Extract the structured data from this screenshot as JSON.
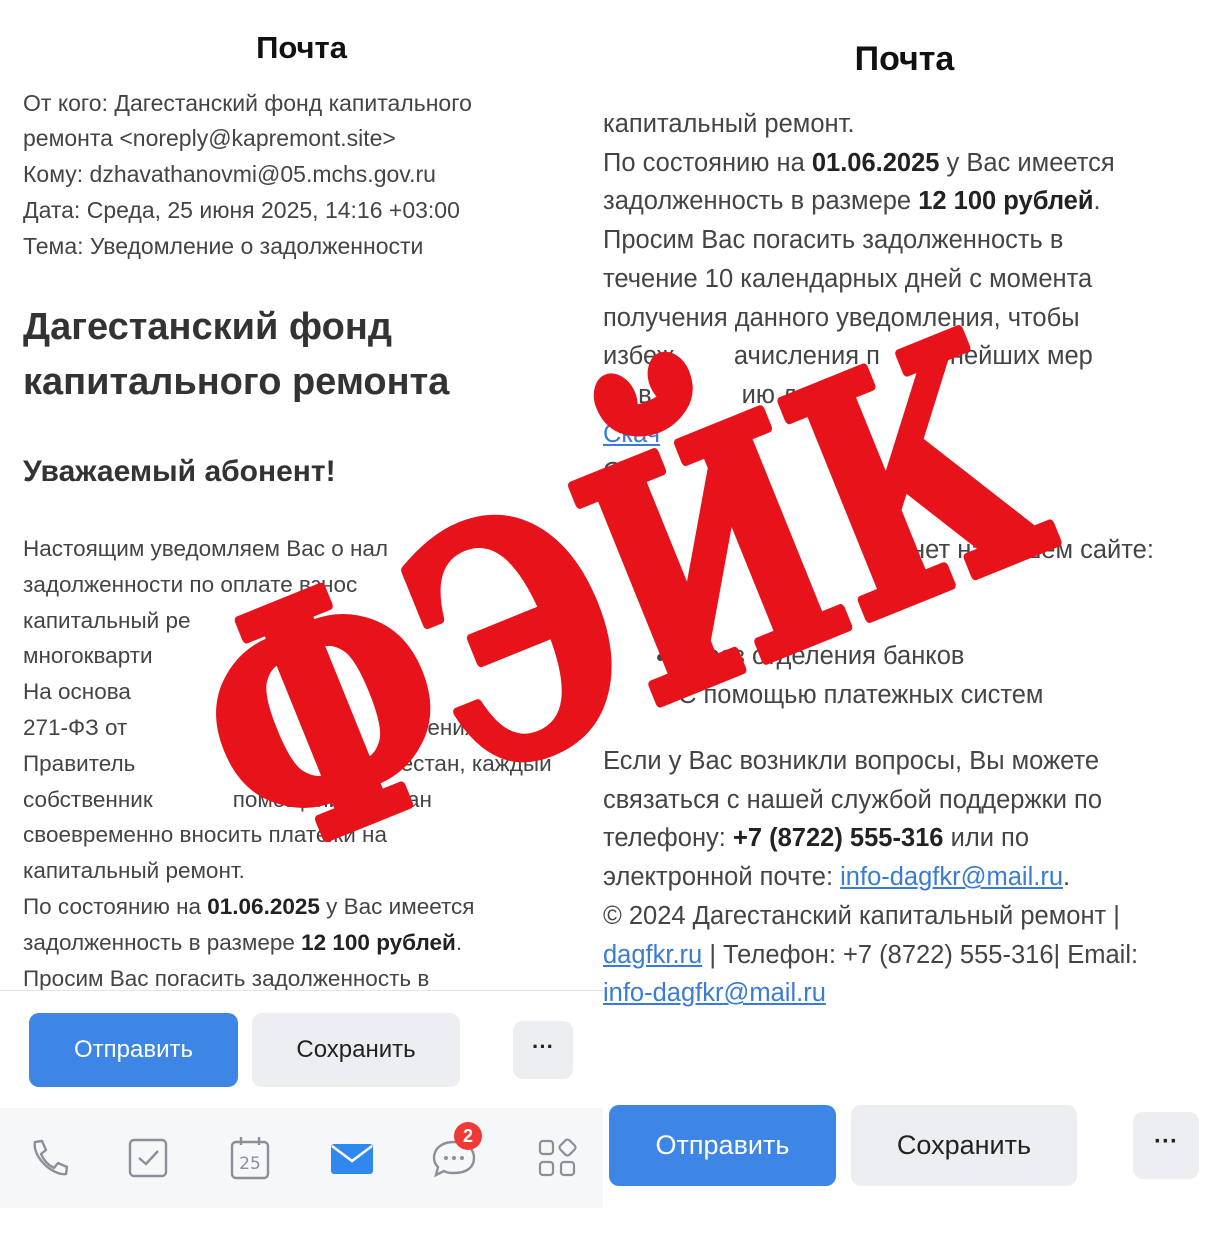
{
  "left": {
    "title": "Почта",
    "header": {
      "from_1": "От кого: Дагестанский фонд капитального",
      "from_2": "ремонта <noreply@kapremont.site>",
      "to": "Кому: dzhavathanovmi@05.mchs.gov.ru",
      "date": "Дата: Среда, 25 июня 2025, 14:16 +03:00",
      "subject": "Тема: Уведомление о задолженности"
    },
    "org_line_1": "Дагестанский фонд",
    "org_line_2": "капитального ремонта",
    "greeting": "Уважаемый абонент!",
    "body": {
      "l1": "Настоящим уведомляем Вас о нал",
      "l2": "задолженности по оплате взнос",
      "l3": "капитальный ре",
      "l4": "многокварти",
      "l5": "На основа",
      "l6": "271-ФЗ от",
      "l6b": "ения",
      "l7": "Правитель",
      "l7b": "агестан, каждый",
      "l8": "собственник",
      "l8b": "помещения обязан",
      "l9": "своевременно вносить платежи на",
      "l10": "капитальный ремонт.",
      "l11_pre": "По состоянию на ",
      "l11_date": "01.06.2025",
      "l11_post": " у Вас имеется",
      "l12_pre": "задолженность в размере ",
      "l12_amount": "12 100 рублей",
      "l12_post": ".",
      "l13": "Просим Вас погасить задолженность в"
    },
    "buttons": {
      "send": "Отправить",
      "save": "Сохранить",
      "more": "···"
    },
    "tabbar": {
      "calendar_day": "25",
      "chat_badge": "2"
    }
  },
  "right": {
    "title": "Почта",
    "body": {
      "l1": "капитальный ремонт.",
      "l2_pre": "По состоянию на ",
      "l2_date": "01.06.2025",
      "l2_post": " у Вас имеется",
      "l3_pre": "задолженность в размере ",
      "l3_amount": "12 100 рублей",
      "l3_post": ".",
      "l4": "Просим Вас погасить задолженность в",
      "l5": "течение 10 календарных дней с момента",
      "l6": "получения данного уведомления, чтобы",
      "l7a": "избеж",
      "l7b": "ачисления п",
      "l7c": "нейших мер",
      "l8a": "по в",
      "l8b": "ию д",
      "l9_link": "Скач",
      "l10": "С",
      "l11": "абинет на нашем сайте:"
    },
    "bullets": [
      "через отделения банков",
      "С помощью платежных систем"
    ],
    "contact": {
      "l1": "Если у Вас возникли вопросы, Вы можете",
      "l2": "связаться с нашей службой поддержки по",
      "l3_pre": "телефону: ",
      "l3_phone": "+7 (8722) 555-316",
      "l3_post": " или по",
      "l4_pre": "электронной почте: ",
      "l4_email": "info-dagfkr@mail.ru",
      "l4_post": ".",
      "l5": "© 2024 Дагестанский капитальный ремонт |",
      "l6_link": "dagfkr.ru",
      "l6_post": " | Телефон: +7 (8722) 555-316| Email:",
      "l7_email": "info-dagfkr@mail.ru"
    },
    "buttons": {
      "send": "Отправить",
      "save": "Сохранить",
      "more": "···"
    }
  },
  "stamp": {
    "text": "ФЭЙК",
    "color": "#e8121a"
  },
  "colors": {
    "accent": "#3d86e6",
    "link": "#3a7bd5",
    "badge": "#ee3b36"
  },
  "icons": [
    "phone-icon",
    "task-icon",
    "calendar-icon",
    "mail-icon",
    "chat-icon",
    "apps-icon",
    "more-icon"
  ]
}
